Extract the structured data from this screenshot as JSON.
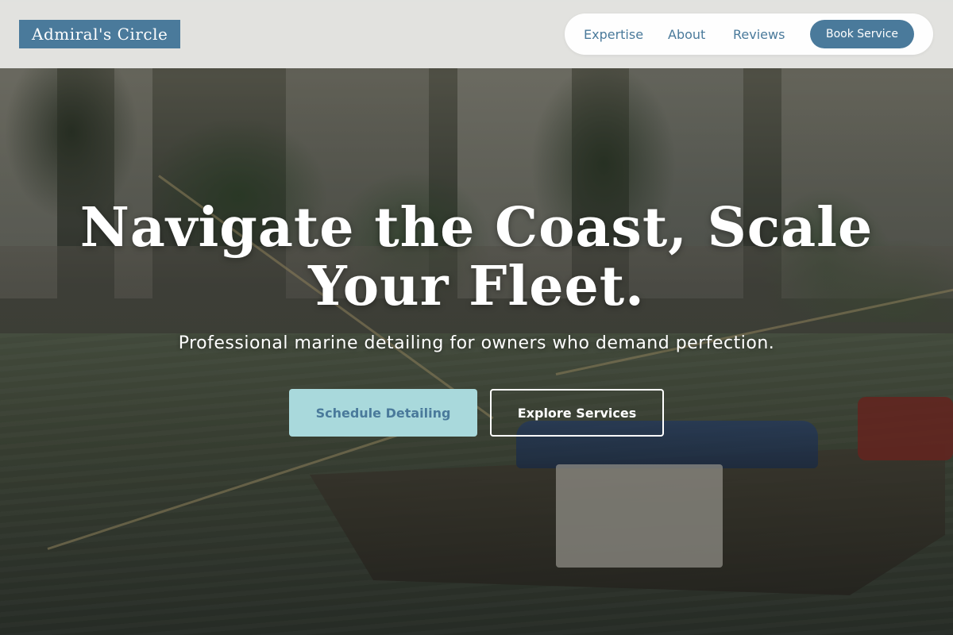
{
  "brand": {
    "logo_text": "Admiral's Circle",
    "accent_color": "#4a7a9b",
    "cta_color": "#a9d9dc"
  },
  "nav": {
    "links": [
      {
        "label": "Expertise"
      },
      {
        "label": "About"
      },
      {
        "label": "Reviews"
      }
    ],
    "book_label": "Book Service"
  },
  "hero": {
    "headline_line1": "Navigate the Coast, Scale",
    "headline_line2": "Your Fleet.",
    "subheadline": "Professional marine detailing for owners who demand perfection.",
    "primary_cta": "Schedule Detailing",
    "secondary_cta": "Explore Services",
    "background": "photo-canal-boat"
  }
}
